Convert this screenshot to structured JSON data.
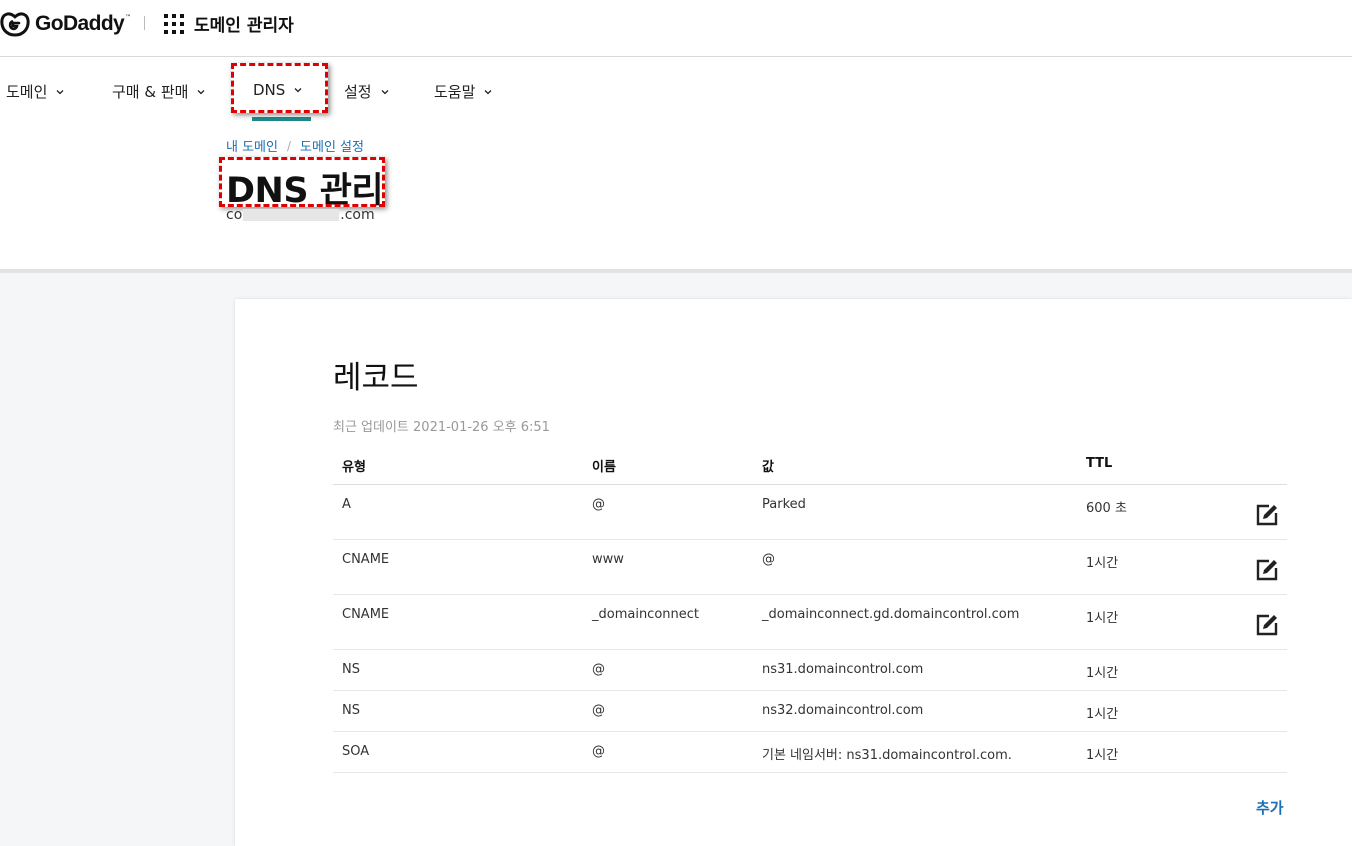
{
  "header": {
    "logo_text": "GoDaddy",
    "logo_tm": "™",
    "app_title": "도메인 관리자"
  },
  "nav": {
    "items": [
      {
        "label": "도메인"
      },
      {
        "label": "구매 & 판매"
      },
      {
        "label": "DNS",
        "active": true
      },
      {
        "label": "설정"
      },
      {
        "label": "도움말"
      }
    ]
  },
  "breadcrumb": {
    "items": [
      "내 도메인",
      "도메인 설정"
    ],
    "separator": "/"
  },
  "page": {
    "title": "DNS 관리",
    "domain_prefix": "co",
    "domain_suffix": ".com"
  },
  "records": {
    "title": "레코드",
    "last_updated": "최근 업데이트 2021-01-26 오후 6:51",
    "columns": {
      "type": "유형",
      "name": "이름",
      "value": "값",
      "ttl": "TTL"
    },
    "rows": [
      {
        "type": "A",
        "name": "@",
        "value": "Parked",
        "ttl": "600 초",
        "editable": true
      },
      {
        "type": "CNAME",
        "name": "www",
        "value": "@",
        "ttl": "1시간",
        "editable": true
      },
      {
        "type": "CNAME",
        "name": "_domainconnect",
        "value": "_domainconnect.gd.domaincontrol.com",
        "ttl": "1시간",
        "editable": true
      },
      {
        "type": "NS",
        "name": "@",
        "value": "ns31.domaincontrol.com",
        "ttl": "1시간",
        "editable": false
      },
      {
        "type": "NS",
        "name": "@",
        "value": "ns32.domaincontrol.com",
        "ttl": "1시간",
        "editable": false
      },
      {
        "type": "SOA",
        "name": "@",
        "value": "기본 네임서버: ns31.domaincontrol.com.",
        "ttl": "1시간",
        "editable": false
      }
    ],
    "add_label": "추가"
  },
  "colors": {
    "accent_link": "#1a6fb5",
    "nav_underline": "#1f8a8a",
    "highlight": "#e00000"
  },
  "icons": {
    "logo": "godaddy-logo-icon",
    "apps": "app-grid-icon",
    "chevron": "chevron-down-icon",
    "edit": "edit-icon"
  }
}
